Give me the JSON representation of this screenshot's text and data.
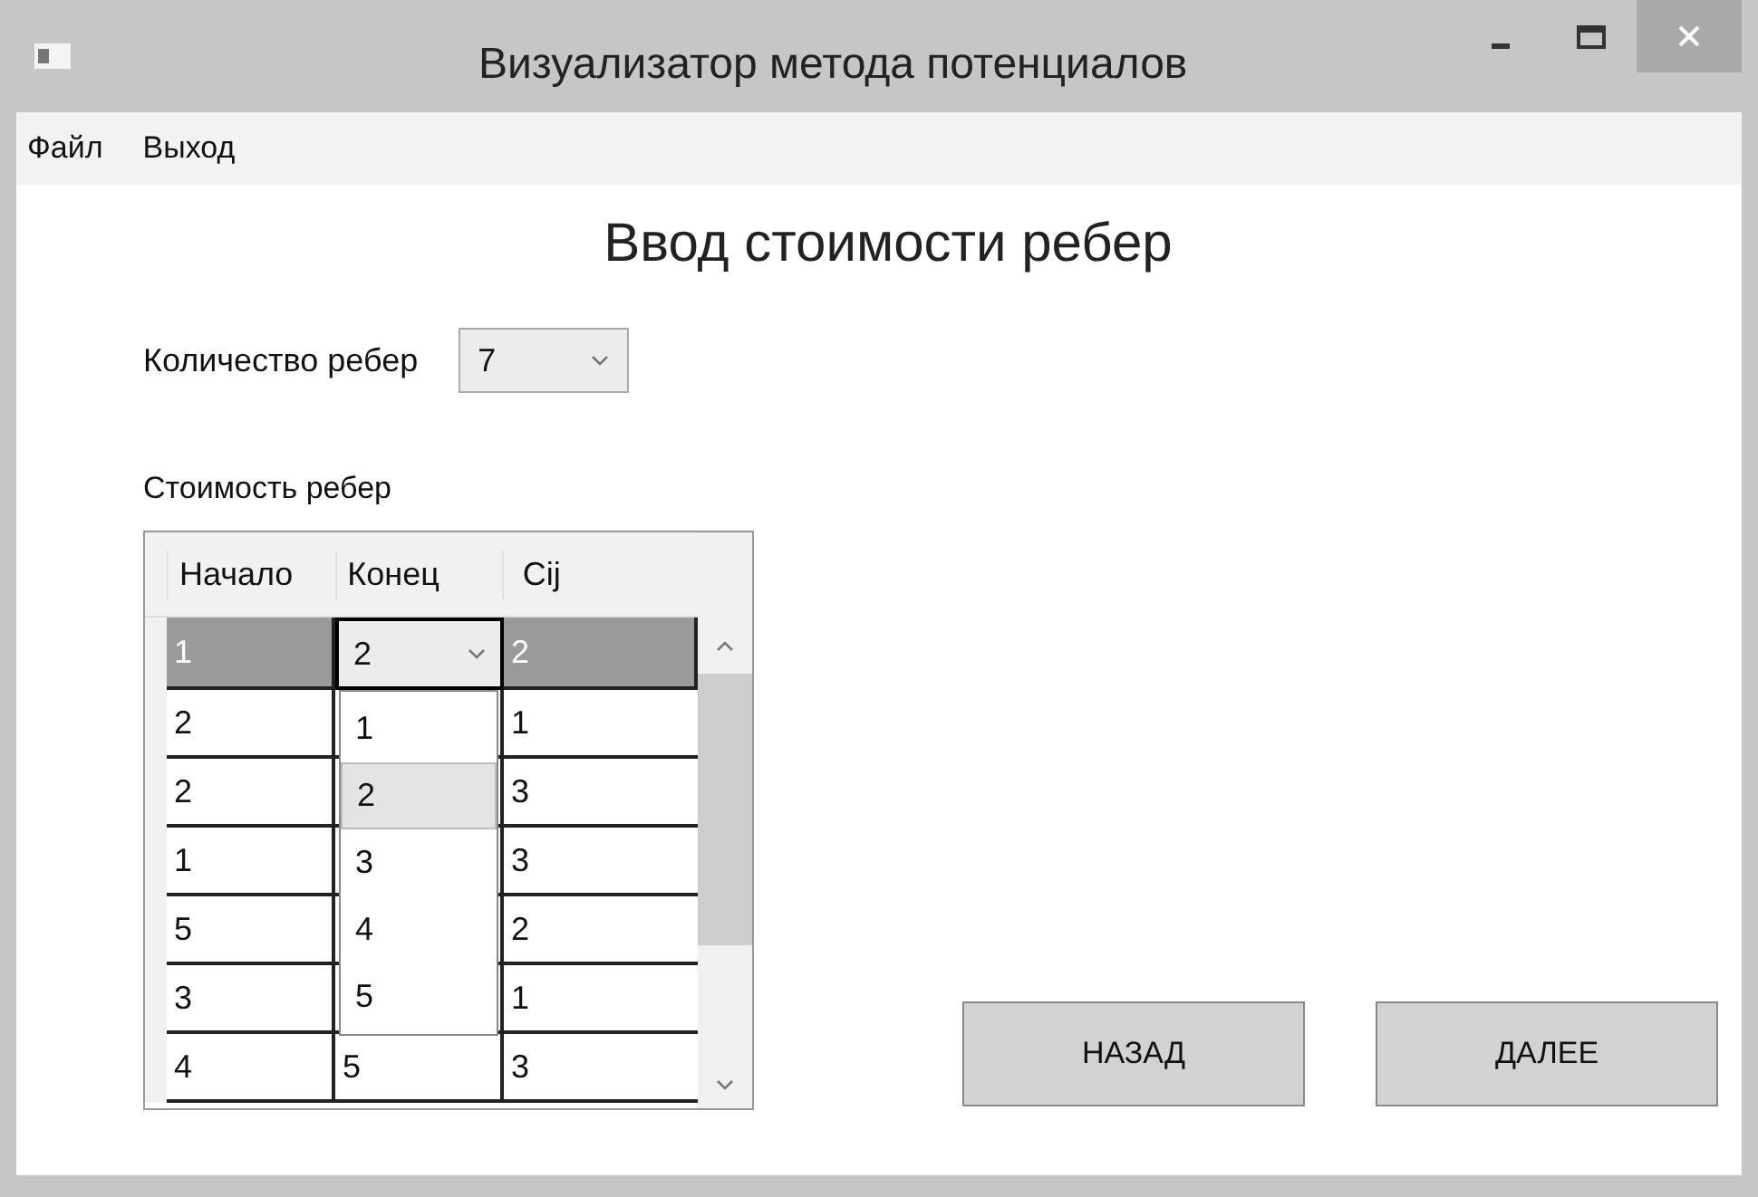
{
  "window": {
    "title": "Визуализатор метода потенциалов"
  },
  "menu": [
    "Файл",
    "Выход"
  ],
  "heading": "Ввод стоимости ребер",
  "edge_count": {
    "label": "Количество ребер",
    "value": "7"
  },
  "costs": {
    "label": "Стоимость ребер",
    "columns": [
      "Начало",
      "Конец",
      "Cij"
    ],
    "rows": [
      {
        "start": "1",
        "end": "2",
        "cost": "2",
        "selected": true
      },
      {
        "start": "2",
        "cost": "1",
        "selected": false
      },
      {
        "start": "2",
        "cost": "3",
        "selected": false
      },
      {
        "start": "1",
        "cost": "3",
        "selected": false
      },
      {
        "start": "5",
        "cost": "2",
        "selected": false
      },
      {
        "start": "3",
        "cost": "1",
        "selected": false
      },
      {
        "start": "4",
        "end": "5",
        "cost": "3",
        "selected": false
      }
    ],
    "dropdown": [
      {
        "label": "1",
        "selected": false
      },
      {
        "label": "2",
        "selected": true
      },
      {
        "label": "3",
        "selected": false
      },
      {
        "label": "4",
        "selected": false
      },
      {
        "label": "5",
        "selected": false
      }
    ]
  },
  "buttons": [
    "НАЗАД",
    "ДАЛЕЕ"
  ]
}
